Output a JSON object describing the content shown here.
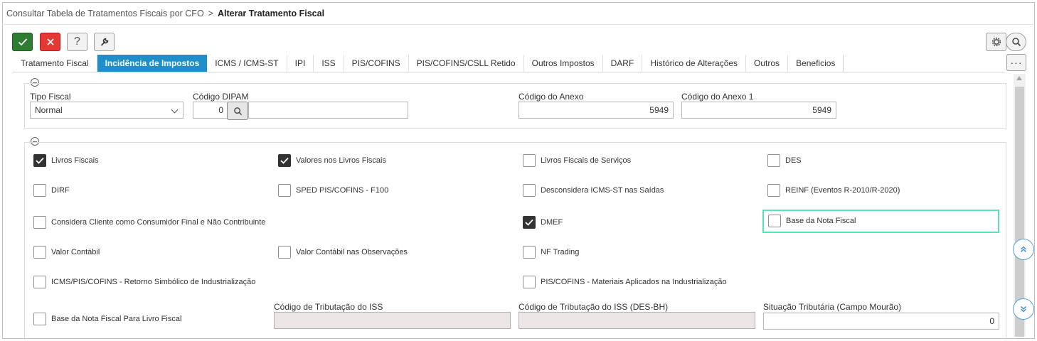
{
  "breadcrumb": {
    "parent": "Consultar Tabela de Tratamentos Fiscais por CFO",
    "separator": ">",
    "current": "Alterar Tratamento Fiscal"
  },
  "toolbar": {
    "help_label": "?",
    "more_label": "···",
    "colors": {
      "confirm": "#2e7d32",
      "cancel": "#e53935"
    }
  },
  "tabs": [
    {
      "label": "Tratamento Fiscal",
      "active": false
    },
    {
      "label": "Incidência de Impostos",
      "active": true
    },
    {
      "label": "ICMS / ICMS-ST",
      "active": false
    },
    {
      "label": "IPI",
      "active": false
    },
    {
      "label": "ISS",
      "active": false
    },
    {
      "label": "PIS/COFINS",
      "active": false
    },
    {
      "label": "PIS/COFINS/CSLL Retido",
      "active": false
    },
    {
      "label": "Outros Impostos",
      "active": false
    },
    {
      "label": "DARF",
      "active": false
    },
    {
      "label": "Histórico de Alterações",
      "active": false
    },
    {
      "label": "Outros",
      "active": false
    },
    {
      "label": "Beneficios",
      "active": false
    }
  ],
  "section1": {
    "tipo_fiscal": {
      "label": "Tipo Fiscal",
      "value": "Normal"
    },
    "codigo_dipam": {
      "label": "Código DIPAM",
      "value": "0",
      "description": ""
    },
    "codigo_anexo": {
      "label": "Código do Anexo",
      "value": "5949"
    },
    "codigo_anexo1": {
      "label": "Código do Anexo 1",
      "value": "5949"
    }
  },
  "checkboxes": [
    {
      "label": "Livros Fiscais",
      "checked": true
    },
    {
      "label": "Valores nos Livros Fiscais",
      "checked": true
    },
    {
      "label": "Livros Fiscais de Serviços",
      "checked": false
    },
    {
      "label": "DES",
      "checked": false
    },
    {
      "label": "DIRF",
      "checked": false
    },
    {
      "label": "SPED PIS/COFINS - F100",
      "checked": false
    },
    {
      "label": "Desconsidera ICMS-ST nas Saídas",
      "checked": false
    },
    {
      "label": "REINF (Eventos R-2010/R-2020)",
      "checked": false
    },
    {
      "label": "Considera Cliente como Consumidor Final e Não Contribuinte",
      "checked": false
    },
    {
      "label": "DMEF",
      "checked": true
    },
    {
      "label": "Base da Nota Fiscal",
      "checked": false,
      "focused": true
    },
    {
      "label": "Valor Contábil",
      "checked": false
    },
    {
      "label": "Valor Contábil nas Observações",
      "checked": false
    },
    {
      "label": "NF Trading",
      "checked": false
    },
    {
      "label": "ICMS/PIS/COFINS - Retorno Simbólico de Industrialização",
      "checked": false
    },
    {
      "label": "PIS/COFINS - Materiais Aplicados na Industrialização",
      "checked": false
    },
    {
      "label": "Base da Nota Fiscal Para Livro Fiscal",
      "checked": false
    }
  ],
  "section2_fields": {
    "codigo_tributacao_iss": {
      "label": "Código de Tributação do ISS",
      "value": ""
    },
    "codigo_tributacao_iss_desbh": {
      "label": "Código de Tributação do ISS (DES-BH)",
      "value": ""
    },
    "situacao_tributaria": {
      "label": "Situação Tributária (Campo Mourão)",
      "value": "0"
    }
  },
  "highlight_color": "#59e3b4"
}
